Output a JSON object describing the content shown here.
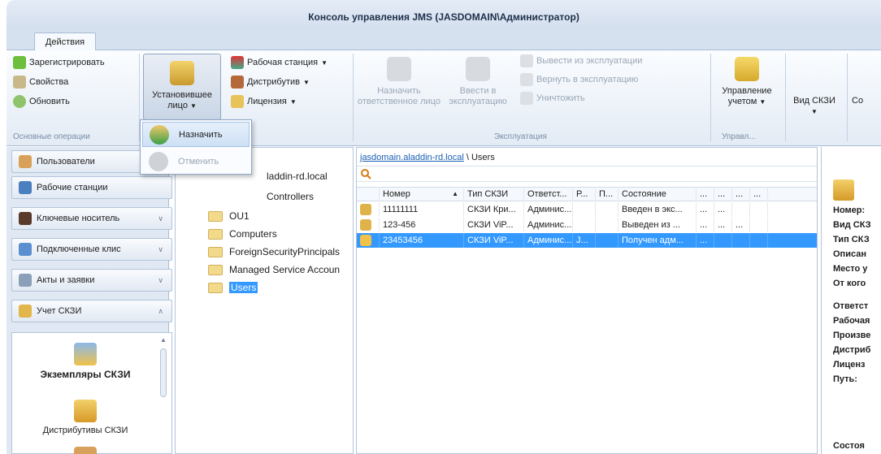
{
  "window": {
    "title": "Консоль управления JMS (JASDOMAIN\\Администратор)"
  },
  "ribbon": {
    "tab": "Действия",
    "basic": {
      "register": "Зарегистрировать",
      "properties": "Свойства",
      "refresh": "Обновить",
      "group_label": "Основные операции"
    },
    "installer": {
      "label_line1": "Установившее",
      "label_line2": "лицо"
    },
    "workstation": "Рабочая станция",
    "distributive": "Дистрибутив",
    "license": "Лицензия",
    "exploitation": {
      "assign_line1": "Назначить",
      "assign_line2": "ответственное лицо",
      "enter_line1": "Ввести в",
      "enter_line2": "эксплуатацию",
      "decommission": "Вывести из эксплуатации",
      "return": "Вернуть в эксплуатацию",
      "destroy": "Уничтожить",
      "group_label": "Эксплуатация"
    },
    "accounting": {
      "label_line1": "Управление",
      "label_line2": "учетом",
      "group_label": "Управл..."
    },
    "view": {
      "label": "Вид СКЗИ",
      "next": "Со"
    }
  },
  "dropdown": {
    "assign": "Назначить",
    "cancel": "Отменить"
  },
  "nav": {
    "items": [
      "Пользователи",
      "Рабочие станции",
      "Ключевые носитель",
      "Подключенные клис",
      "Акты и заявки",
      "Учет СКЗИ"
    ],
    "content": [
      "Экземпляры СКЗИ",
      "Дистрибутивы СКЗИ"
    ]
  },
  "tree": {
    "domain_partial": "laddin-rd.local",
    "controllers_partial": "Controllers",
    "items": [
      "OU1",
      "Computers",
      "ForeignSecurityPrincipals",
      "Managed Service Accoun",
      "Users"
    ]
  },
  "list": {
    "crumb_link": "jasdomain.aladdin-rd.local",
    "crumb_sep": "\\",
    "crumb_current": "Users",
    "columns": [
      "Номер",
      "Тип СКЗИ",
      "Ответст...",
      "Р...",
      "П...",
      "Состояние",
      "...",
      "...",
      "...",
      "..."
    ],
    "rows": [
      [
        "11111111",
        "СКЗИ Кри...",
        "Админис...",
        "",
        "",
        "Введен в экс...",
        "...",
        "...",
        "",
        ""
      ],
      [
        "123-456",
        "СКЗИ ViP...",
        "Админис...",
        "",
        "",
        "Выведен из ...",
        "...",
        "...",
        "...",
        ""
      ],
      [
        "23453456",
        "СКЗИ ViP...",
        "Админис...",
        "J...",
        "",
        "Получен адм...",
        "...",
        "",
        "",
        ""
      ]
    ],
    "selected_index": 2
  },
  "details": {
    "labels": [
      "Номер:",
      "Вид СКЗ",
      "Тип СКЗ",
      "Описан",
      "Место у",
      "От кого",
      "Ответст",
      "Рабочая",
      "Произве",
      "Дистриб",
      "Лиценз",
      "Путь:",
      "Состоя"
    ]
  },
  "colors": {
    "accent": "#3399ff",
    "ribbon_border": "#a8bcd6"
  }
}
